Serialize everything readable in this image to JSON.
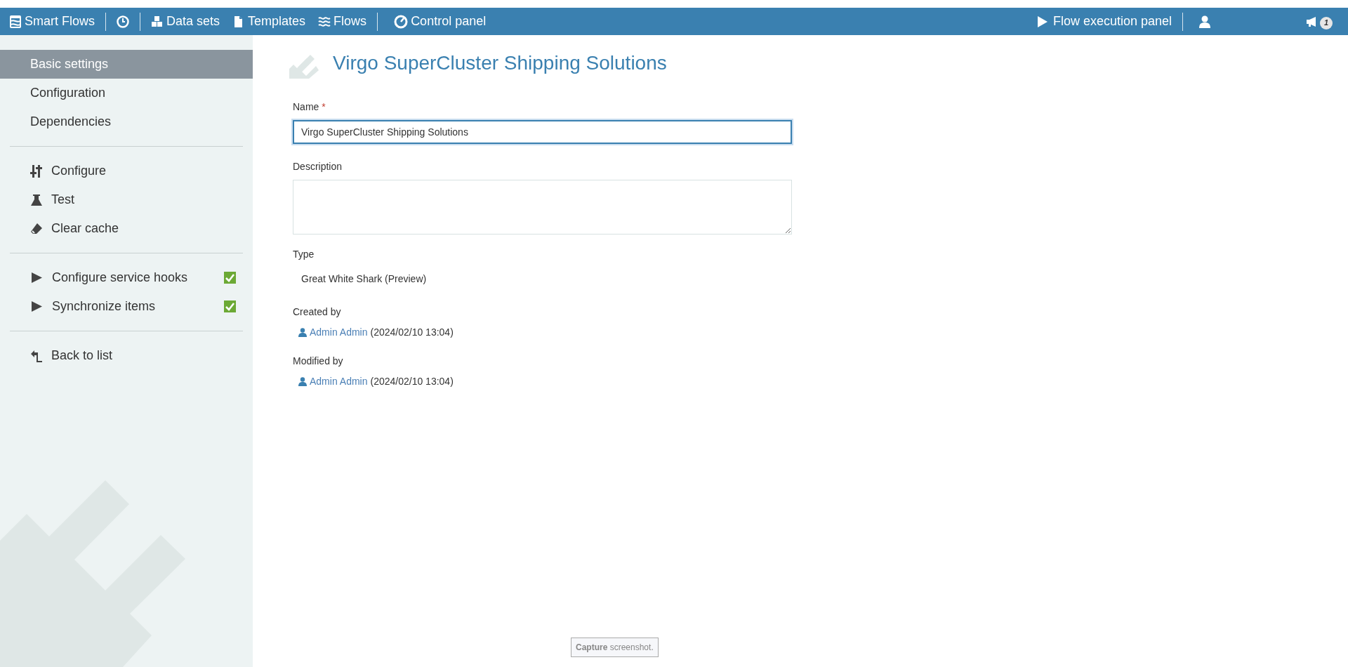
{
  "topbar": {
    "brand": "Smart Flows",
    "left_items": [
      {
        "label": "Data sets"
      },
      {
        "label": "Templates"
      },
      {
        "label": "Flows"
      }
    ],
    "control_panel": "Control panel",
    "flow_execution_panel": "Flow execution panel",
    "notification_count": "1"
  },
  "sidebar": {
    "nav": [
      {
        "label": "Basic settings",
        "selected": true
      },
      {
        "label": "Configuration",
        "selected": false
      },
      {
        "label": "Dependencies",
        "selected": false
      }
    ],
    "actions": [
      {
        "label": "Configure"
      },
      {
        "label": "Test"
      },
      {
        "label": "Clear cache"
      }
    ],
    "toggles": [
      {
        "label": "Configure service hooks",
        "checked": true
      },
      {
        "label": "Synchronize items",
        "checked": true
      }
    ],
    "back": "Back to list"
  },
  "page": {
    "title": "Virgo SuperCluster Shipping Solutions",
    "fields": [
      {
        "kind": "input",
        "label": "Name",
        "required_marker": "*",
        "value": "Virgo SuperCluster Shipping Solutions"
      },
      {
        "kind": "textarea",
        "label": "Description"
      },
      {
        "kind": "text",
        "label": "Type",
        "value": "Great White Shark (Preview)"
      },
      {
        "kind": "user",
        "label": "Created by",
        "user": "Admin Admin",
        "date": "(2024/02/10 13:04)"
      },
      {
        "kind": "user",
        "label": "Modified by",
        "user": "Admin Admin",
        "date": "(2024/02/10 13:04)"
      }
    ]
  },
  "tooltip": "**Capture** screenshot."
}
